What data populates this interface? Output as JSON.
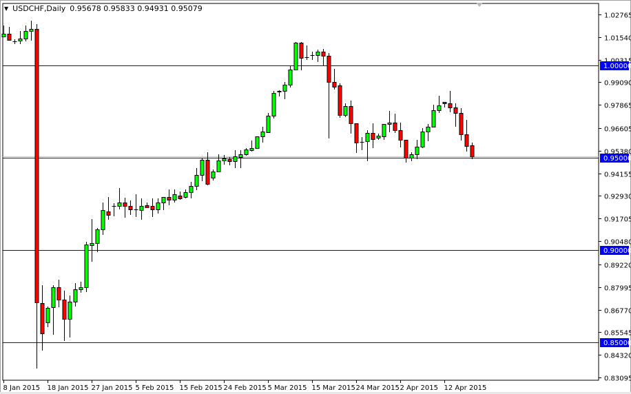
{
  "header": {
    "symbol_timeframe": "USDCHF,Daily",
    "quote": "0.95678 0.95833 0.94931 0.95079"
  },
  "colors": {
    "up": "#00ff00",
    "down": "#ff0000",
    "level_line": "#0000ff",
    "bid_line": "#c0c0c0",
    "label_bg": "#0000ff"
  },
  "chart_data": {
    "type": "candlestick",
    "title": "USDCHF,Daily",
    "ohlc_readout": {
      "open": 0.95678,
      "high": 0.95833,
      "low": 0.94931,
      "close": 0.95079
    },
    "ylim": [
      0.8292,
      1.0307
    ],
    "y_ticks": [
      "1.02765",
      "1.01540",
      "1.00315",
      "0.99090",
      "0.97865",
      "0.96605",
      "0.95380",
      "0.94155",
      "0.92930",
      "0.91705",
      "0.90480",
      "0.89220",
      "0.87995",
      "0.86770",
      "0.85545",
      "0.84320",
      "0.83095"
    ],
    "x_tick_labels": [
      {
        "index": 0,
        "label": "8 Jan 2015"
      },
      {
        "index": 8,
        "label": "18 Jan 2015"
      },
      {
        "index": 16,
        "label": "27 Jan 2015"
      },
      {
        "index": 24,
        "label": "5 Feb 2015"
      },
      {
        "index": 32,
        "label": "15 Feb 2015"
      },
      {
        "index": 40,
        "label": "24 Feb 2015"
      },
      {
        "index": 48,
        "label": "5 Mar 2015"
      },
      {
        "index": 56,
        "label": "15 Mar 2015"
      },
      {
        "index": 64,
        "label": "24 Mar 2015"
      },
      {
        "index": 72,
        "label": "2 Apr 2015"
      },
      {
        "index": 80,
        "label": "12 Apr 2015"
      }
    ],
    "horizontal_levels": [
      {
        "value": 1.0,
        "label": "1.00000"
      },
      {
        "value": 0.95,
        "label": "0.95000"
      },
      {
        "value": 0.9,
        "label": "0.90000"
      },
      {
        "value": 0.85,
        "label": "0.85000"
      }
    ],
    "bid": 0.95079,
    "candles": [
      [
        1.0158,
        1.0218,
        1.0154,
        1.0173
      ],
      [
        1.0173,
        1.021,
        1.0135,
        1.0139
      ],
      [
        1.0132,
        1.0143,
        1.0117,
        1.013
      ],
      [
        1.0135,
        1.0188,
        1.0117,
        1.0147
      ],
      [
        1.0147,
        1.0218,
        1.0132,
        1.0188
      ],
      [
        1.0188,
        1.0241,
        1.0135,
        1.0199
      ],
      [
        1.0199,
        1.0225,
        0.8357,
        0.8718
      ],
      [
        0.8714,
        0.8808,
        0.8455,
        0.8549
      ],
      [
        0.8609,
        0.8695,
        0.8583,
        0.8688
      ],
      [
        0.8692,
        0.8808,
        0.8541,
        0.8797
      ],
      [
        0.8797,
        0.8838,
        0.8692,
        0.8733
      ],
      [
        0.8733,
        0.8778,
        0.8508,
        0.8628
      ],
      [
        0.8628,
        0.8752,
        0.8526,
        0.8722
      ],
      [
        0.8722,
        0.882,
        0.8695,
        0.8786
      ],
      [
        0.8789,
        0.8827,
        0.8767,
        0.8797
      ],
      [
        0.8797,
        0.9045,
        0.8771,
        0.903
      ],
      [
        0.9026,
        0.9169,
        0.8936,
        0.9038
      ],
      [
        0.9038,
        0.912,
        0.8989,
        0.9113
      ],
      [
        0.9113,
        0.9256,
        0.9083,
        0.9218
      ],
      [
        0.921,
        0.9286,
        0.9165,
        0.9192
      ],
      [
        0.924,
        0.9252,
        0.9184,
        0.9238
      ],
      [
        0.9237,
        0.9335,
        0.9222,
        0.9256
      ],
      [
        0.9256,
        0.9282,
        0.9177,
        0.924
      ],
      [
        0.924,
        0.9267,
        0.9192,
        0.9222
      ],
      [
        0.9222,
        0.9304,
        0.918,
        0.922
      ],
      [
        0.9218,
        0.9278,
        0.9165,
        0.924
      ],
      [
        0.9244,
        0.9256,
        0.9229,
        0.9233
      ],
      [
        0.9237,
        0.9278,
        0.918,
        0.9222
      ],
      [
        0.9222,
        0.9278,
        0.9199,
        0.9259
      ],
      [
        0.9259,
        0.9289,
        0.9218,
        0.9286
      ],
      [
        0.9286,
        0.9327,
        0.9244,
        0.9271
      ],
      [
        0.9271,
        0.9327,
        0.9256,
        0.9301
      ],
      [
        0.9293,
        0.9316,
        0.9271,
        0.9278
      ],
      [
        0.9286,
        0.9327,
        0.9278,
        0.9312
      ],
      [
        0.9312,
        0.9368,
        0.9278,
        0.9346
      ],
      [
        0.9346,
        0.9444,
        0.9323,
        0.9406
      ],
      [
        0.9406,
        0.9496,
        0.9372,
        0.9489
      ],
      [
        0.9489,
        0.953,
        0.935,
        0.9357
      ],
      [
        0.9391,
        0.9436,
        0.9376,
        0.9425
      ],
      [
        0.9425,
        0.9519,
        0.9423,
        0.9485
      ],
      [
        0.9485,
        0.9515,
        0.9462,
        0.9496
      ],
      [
        0.9492,
        0.9504,
        0.9459,
        0.9481
      ],
      [
        0.9481,
        0.9541,
        0.9444,
        0.9507
      ],
      [
        0.9504,
        0.9541,
        0.9444,
        0.9519
      ],
      [
        0.9519,
        0.9553,
        0.9511,
        0.9545
      ],
      [
        0.9541,
        0.9594,
        0.9534,
        0.9553
      ],
      [
        0.9553,
        0.9617,
        0.9549,
        0.9617
      ],
      [
        0.9617,
        0.9669,
        0.9583,
        0.9643
      ],
      [
        0.9639,
        0.9744,
        0.9635,
        0.9726
      ],
      [
        0.9726,
        0.9861,
        0.9714,
        0.985
      ],
      [
        0.9861,
        0.9865,
        0.9831,
        0.9859
      ],
      [
        0.9861,
        0.991,
        0.9816,
        0.9895
      ],
      [
        0.9895,
        0.9996,
        0.988,
        0.9977
      ],
      [
        0.9977,
        1.0128,
        0.9974,
        1.0124
      ],
      [
        1.0124,
        1.0128,
        0.9974,
        1.0041
      ],
      [
        1.0045,
        1.0109,
        1.003,
        1.0043
      ],
      [
        1.0056,
        1.0075,
        1.003,
        1.0055
      ],
      [
        1.0056,
        1.0086,
        1.0019,
        1.0075
      ],
      [
        1.0075,
        1.009,
        1.0,
        1.0053
      ],
      [
        1.0053,
        1.0068,
        0.9605,
        0.991
      ],
      [
        0.991,
        0.9981,
        0.9868,
        0.9883
      ],
      [
        0.9891,
        0.9902,
        0.9718,
        0.9733
      ],
      [
        0.9733,
        0.9793,
        0.9722,
        0.9778
      ],
      [
        0.9778,
        0.9808,
        0.9632,
        0.9688
      ],
      [
        0.9688,
        0.9688,
        0.9526,
        0.9583
      ],
      [
        0.9587,
        0.9613,
        0.9541,
        0.9585
      ],
      [
        0.959,
        0.965,
        0.9481,
        0.9635
      ],
      [
        0.9635,
        0.9688,
        0.9553,
        0.9601
      ],
      [
        0.9609,
        0.9632,
        0.9598,
        0.962
      ],
      [
        0.9617,
        0.9684,
        0.9598,
        0.9684
      ],
      [
        0.9684,
        0.9752,
        0.9639,
        0.9692
      ],
      [
        0.9692,
        0.9737,
        0.9635,
        0.965
      ],
      [
        0.965,
        0.9692,
        0.9556,
        0.9598
      ],
      [
        0.9598,
        0.9598,
        0.9474,
        0.95
      ],
      [
        0.95,
        0.953,
        0.9481,
        0.9519
      ],
      [
        0.9519,
        0.9598,
        0.9492,
        0.956
      ],
      [
        0.956,
        0.9662,
        0.9553,
        0.9643
      ],
      [
        0.9643,
        0.9684,
        0.959,
        0.9669
      ],
      [
        0.9669,
        0.9786,
        0.9669,
        0.9756
      ],
      [
        0.9756,
        0.9834,
        0.9744,
        0.9782
      ],
      [
        0.9801,
        0.9801,
        0.9774,
        0.9793
      ],
      [
        0.9793,
        0.9861,
        0.9748,
        0.9771
      ],
      [
        0.9771,
        0.9793,
        0.9669,
        0.9744
      ],
      [
        0.9744,
        0.9767,
        0.9594,
        0.9628
      ],
      [
        0.9628,
        0.9707,
        0.9534,
        0.9564
      ],
      [
        0.95678,
        0.95833,
        0.94931,
        0.95079
      ]
    ]
  }
}
